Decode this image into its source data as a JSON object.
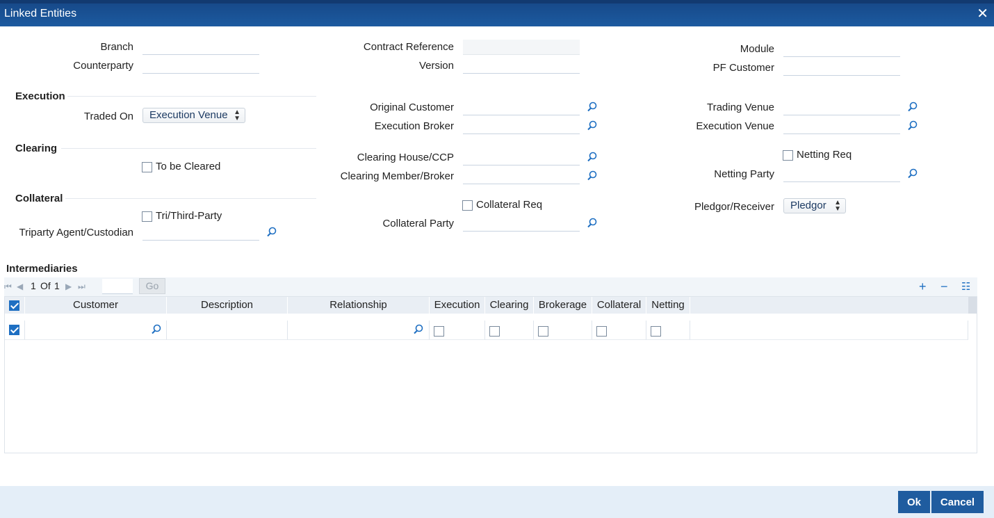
{
  "window": {
    "title": "Linked Entities",
    "close_icon": "close-icon"
  },
  "header": {
    "branch_label": "Branch",
    "counterparty_label": "Counterparty",
    "contract_reference_label": "Contract Reference",
    "version_label": "Version",
    "module_label": "Module",
    "pf_customer_label": "PF Customer"
  },
  "execution": {
    "section_title": "Execution",
    "traded_on_label": "Traded On",
    "traded_on_value": "Execution Venue",
    "original_customer_label": "Original Customer",
    "execution_broker_label": "Execution Broker",
    "trading_venue_label": "Trading Venue",
    "execution_venue_label": "Execution Venue"
  },
  "clearing": {
    "section_title": "Clearing",
    "to_be_cleared_label": "To be Cleared",
    "clearing_house_label": "Clearing House/CCP",
    "clearing_member_label": "Clearing Member/Broker",
    "netting_req_label": "Netting Req",
    "netting_party_label": "Netting Party"
  },
  "collateral": {
    "section_title": "Collateral",
    "tri_third_party_label": "Tri/Third-Party",
    "triparty_agent_label": "Triparty Agent/Custodian",
    "collateral_req_label": "Collateral Req",
    "collateral_party_label": "Collateral Party",
    "pledgor_receiver_label": "Pledgor/Receiver",
    "pledgor_receiver_value": "Pledgor"
  },
  "intermediaries": {
    "section_title": "Intermediaries",
    "page_current": "1",
    "page_of": "Of",
    "page_total": "1",
    "go_label": "Go",
    "columns": [
      "Customer",
      "Description",
      "Relationship",
      "Execution",
      "Clearing",
      "Brokerage",
      "Collateral",
      "Netting"
    ]
  },
  "footer": {
    "ok_label": "Ok",
    "cancel_label": "Cancel"
  },
  "colors": {
    "title_bar": "#1c5aa0",
    "accent": "#1e6fc2",
    "button": "#1f5c9f",
    "footer_bg": "#e4eef8"
  }
}
